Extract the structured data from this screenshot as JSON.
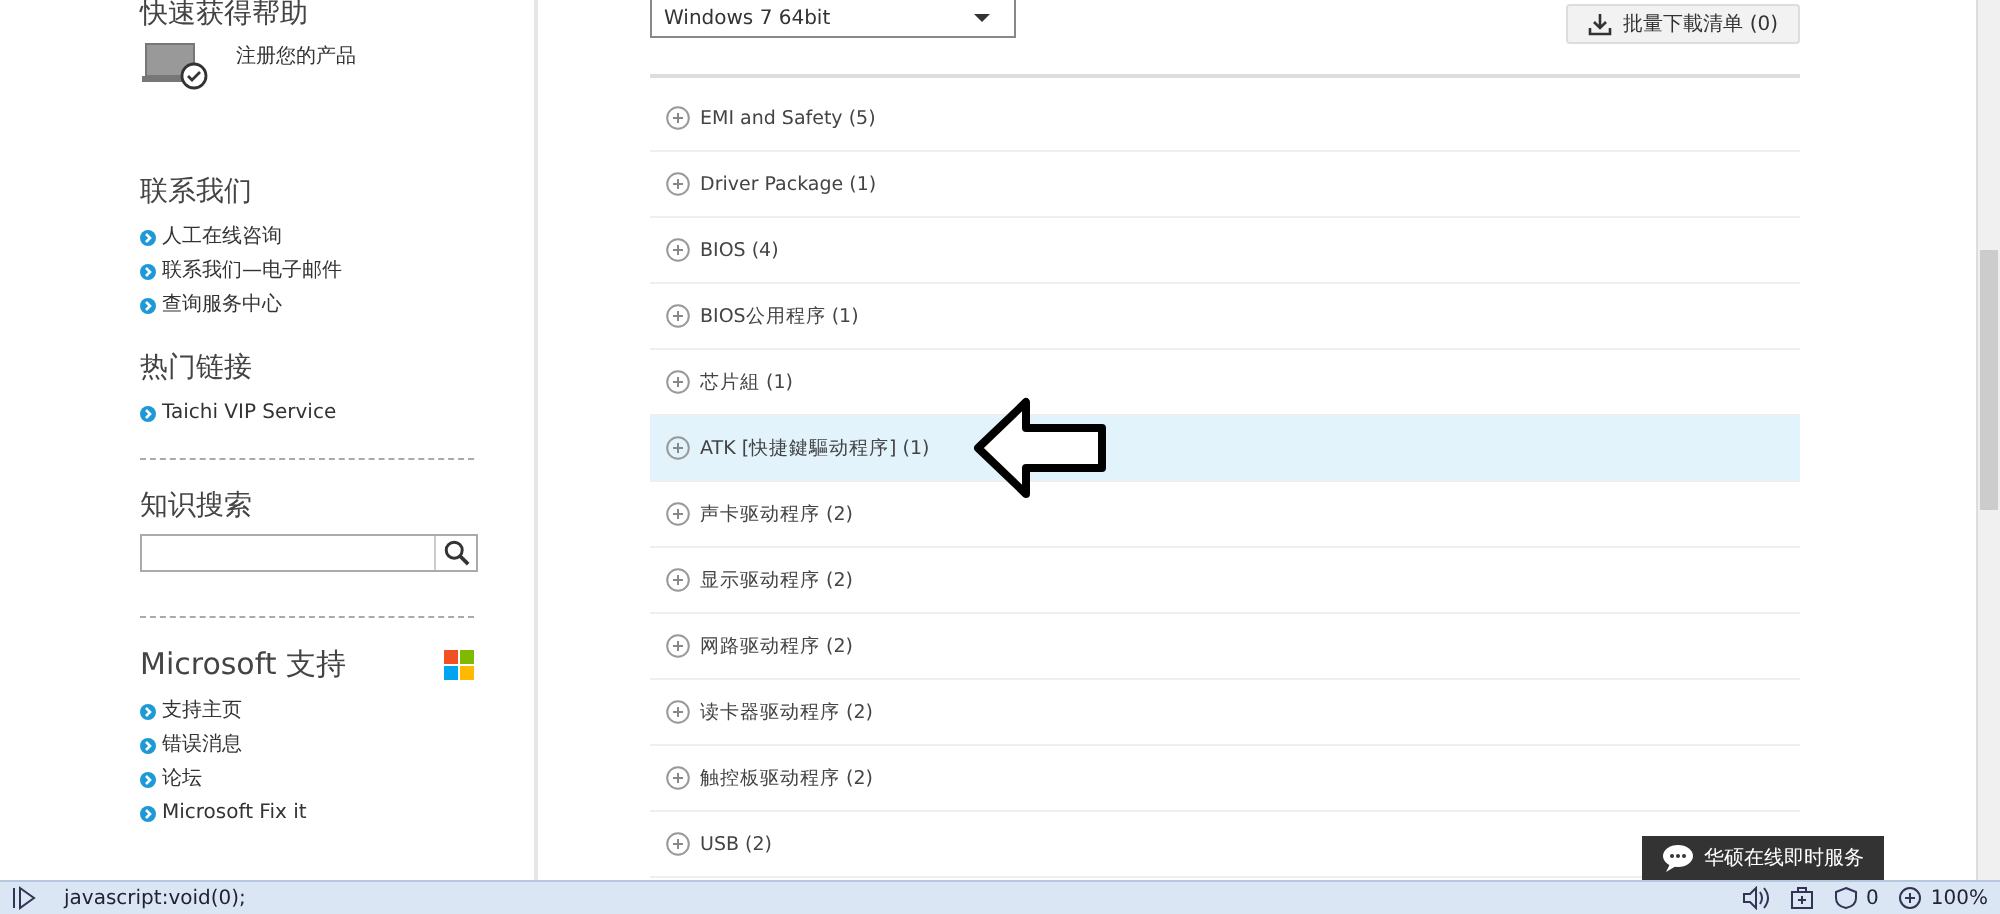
{
  "sidebar": {
    "quick_help": {
      "title": "快速获得帮助",
      "register_link": "注册您的产品"
    },
    "contact": {
      "title": "联系我们",
      "links": [
        "人工在线咨询",
        "联系我们—电子邮件",
        "查询服务中心"
      ]
    },
    "hot_links": {
      "title": "热门链接",
      "links": [
        "Taichi VIP Service"
      ]
    },
    "knowledge_search": {
      "title": "知识搜索"
    },
    "microsoft": {
      "title": "Microsoft 支持",
      "links": [
        "支持主页",
        "错误消息",
        "论坛",
        "Microsoft Fix it"
      ]
    }
  },
  "main": {
    "os_select": {
      "value": "Windows 7 64bit"
    },
    "batch_download_button": "批量下載清单 (0)",
    "categories": [
      {
        "label": "EMI and Safety  (5)",
        "selected": false
      },
      {
        "label": "Driver Package  (1)",
        "selected": false
      },
      {
        "label": "BIOS (4)",
        "selected": false
      },
      {
        "label": "BIOS公用程序 (1)",
        "selected": false
      },
      {
        "label": "芯片組 (1)",
        "selected": false
      },
      {
        "label": "ATK [快捷鍵驅动程序] (1)",
        "selected": true
      },
      {
        "label": "声卡驱动程序  (2)",
        "selected": false
      },
      {
        "label": "显示驱动程序  (2)",
        "selected": false
      },
      {
        "label": "网路驱动程序  (2)",
        "selected": false
      },
      {
        "label": "读卡器驱动程序 (2)",
        "selected": false
      },
      {
        "label": "触控板驱动程序  (2)",
        "selected": false
      },
      {
        "label": "USB (2)",
        "selected": false
      }
    ],
    "chat_button": "华硕在线即时服务"
  },
  "status_bar": {
    "url": "javascript:void(0);",
    "zoom": "100%",
    "blocked_count": "0"
  }
}
